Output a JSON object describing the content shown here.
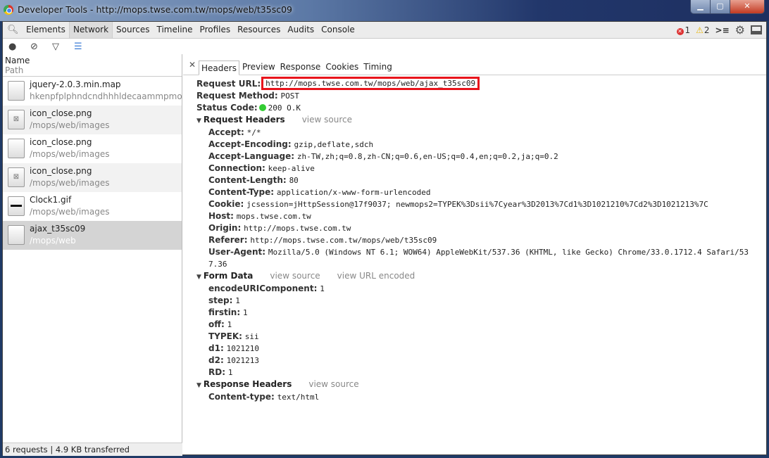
{
  "window": {
    "title": "Developer Tools - http://mops.twse.com.tw/mops/web/t35sc09",
    "min": "▁",
    "max": "▢",
    "close": "✕"
  },
  "toolbar": {
    "tabs": [
      "Elements",
      "Network",
      "Sources",
      "Timeline",
      "Profiles",
      "Resources",
      "Audits",
      "Console"
    ],
    "selected": 1,
    "errors": "1",
    "warnings": "2"
  },
  "list": {
    "name_header": "Name",
    "path_header": "Path",
    "items": [
      {
        "name": "jquery-2.0.3.min.map",
        "path": "hkenpfplphndcndhhhldecaammpmo",
        "icon": "blank-file-icon"
      },
      {
        "name": "icon_close.png",
        "path": "/mops/web/images",
        "icon": "image-close-icon"
      },
      {
        "name": "icon_close.png",
        "path": "/mops/web/images",
        "icon": "blank-file-icon"
      },
      {
        "name": "icon_close.png",
        "path": "/mops/web/images",
        "icon": "image-close-icon"
      },
      {
        "name": "Clock1.gif",
        "path": "/mops/web/images",
        "icon": "gif-image-icon"
      },
      {
        "name": "ajax_t35sc09",
        "path": "/mops/web",
        "icon": "blank-file-icon"
      }
    ],
    "selected": 5,
    "footer": "6 requests | 4.9 KB transferred"
  },
  "detail": {
    "tabs": [
      "Headers",
      "Preview",
      "Response",
      "Cookies",
      "Timing"
    ],
    "selected": 0,
    "general": {
      "url_label": "Request URL:",
      "url": "http://mops.twse.com.tw/mops/web/ajax_t35sc09",
      "method_label": "Request Method:",
      "method": "POST",
      "status_label": "Status Code:",
      "status": "200 O.K",
      "status_color": "#33cc33"
    },
    "request_headers": {
      "title": "Request Headers",
      "view_source": "view source",
      "items": [
        {
          "k": "Accept:",
          "v": "*/*"
        },
        {
          "k": "Accept-Encoding:",
          "v": "gzip,deflate,sdch"
        },
        {
          "k": "Accept-Language:",
          "v": "zh-TW,zh;q=0.8,zh-CN;q=0.6,en-US;q=0.4,en;q=0.2,ja;q=0.2"
        },
        {
          "k": "Connection:",
          "v": "keep-alive"
        },
        {
          "k": "Content-Length:",
          "v": "80"
        },
        {
          "k": "Content-Type:",
          "v": "application/x-www-form-urlencoded"
        },
        {
          "k": "Cookie:",
          "v": "jcsession=jHttpSession@17f9037; newmops2=TYPEK%3Dsii%7Cyear%3D2013%7Cd1%3D1021210%7Cd2%3D1021213%7C"
        },
        {
          "k": "Host:",
          "v": "mops.twse.com.tw"
        },
        {
          "k": "Origin:",
          "v": "http://mops.twse.com.tw"
        },
        {
          "k": "Referer:",
          "v": "http://mops.twse.com.tw/mops/web/t35sc09"
        },
        {
          "k": "User-Agent:",
          "v": "Mozilla/5.0 (Windows NT 6.1; WOW64) AppleWebKit/537.36 (KHTML, like Gecko) Chrome/33.0.1712.4 Safari/537.36"
        }
      ]
    },
    "form_data": {
      "title": "Form Data",
      "view_source": "view source",
      "view_url_encoded": "view URL encoded",
      "items": [
        {
          "k": "encodeURIComponent:",
          "v": "1"
        },
        {
          "k": "step:",
          "v": "1"
        },
        {
          "k": "firstin:",
          "v": "1"
        },
        {
          "k": "off:",
          "v": "1"
        },
        {
          "k": "TYPEK:",
          "v": "sii"
        },
        {
          "k": "d1:",
          "v": "1021210"
        },
        {
          "k": "d2:",
          "v": "1021213"
        },
        {
          "k": "RD:",
          "v": "1"
        }
      ]
    },
    "response_headers": {
      "title": "Response Headers",
      "view_source": "view source",
      "items": [
        {
          "k": "Content-type:",
          "v": "text/html"
        }
      ]
    }
  }
}
